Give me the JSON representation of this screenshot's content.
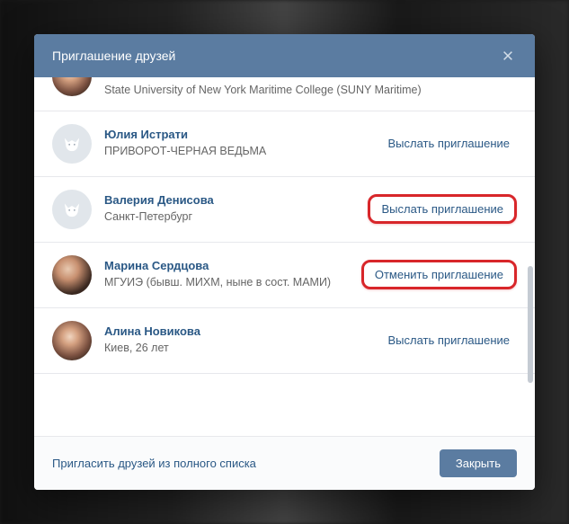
{
  "modal": {
    "title": "Приглашение друзей",
    "footer_link": "Пригласить друзей из полного списка",
    "close_button": "Закрыть"
  },
  "friends": [
    {
      "name": "",
      "sub": "State University of New York Maritime College (SUNY Maritime)",
      "action": "",
      "avatar": "partial",
      "highlight": false
    },
    {
      "name": "Юлия Истрати",
      "sub": "ПРИВОРОТ-ЧЕРНАЯ ВЕДЬМА",
      "action": "Выслать приглашение",
      "avatar": "fox",
      "highlight": false
    },
    {
      "name": "Валерия Денисова",
      "sub": "Санкт-Петербург",
      "action": "Выслать приглашение",
      "avatar": "fox",
      "highlight": true
    },
    {
      "name": "Марина Сердцова",
      "sub": "МГУИЭ (бывш. МИХМ, ныне в сост. МАМИ)",
      "action": "Отменить приглашение",
      "avatar": "photo1",
      "highlight": true
    },
    {
      "name": "Алина Новикова",
      "sub": "Киев, 26 лет",
      "action": "Выслать приглашение",
      "avatar": "photo2",
      "highlight": false
    }
  ]
}
